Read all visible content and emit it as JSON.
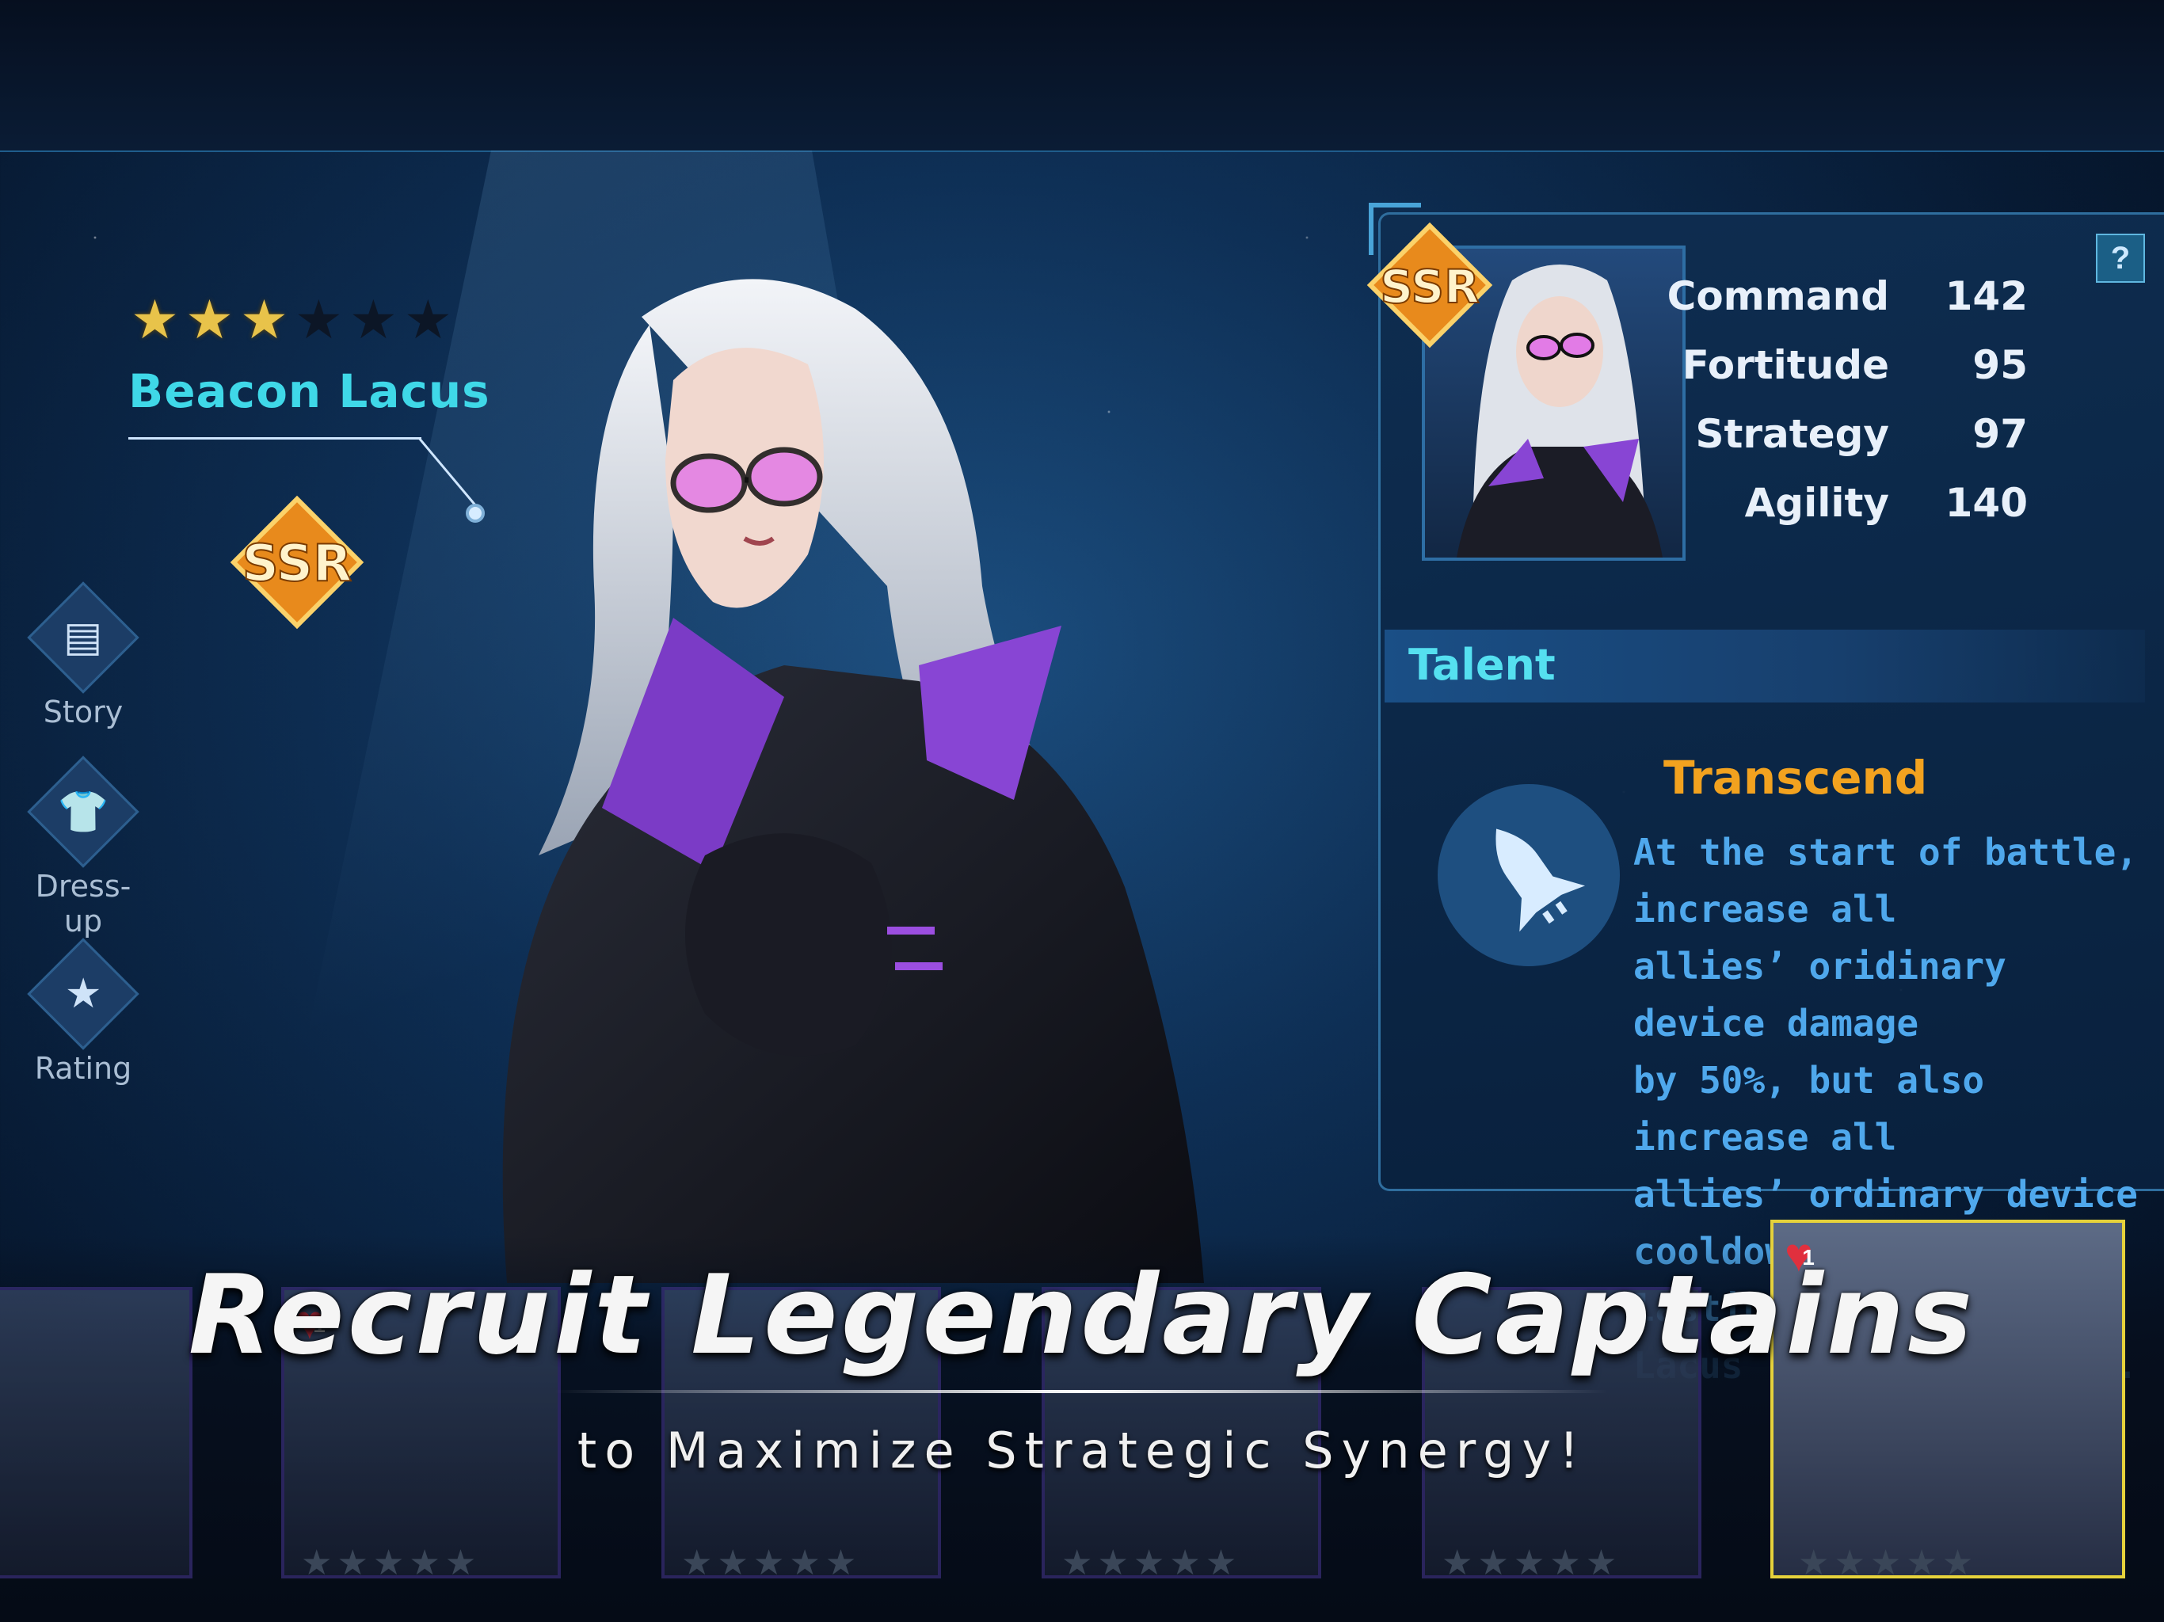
{
  "hero": {
    "stars_filled": 3,
    "stars_total": 6,
    "name": "Beacon Lacus",
    "rarity": "SSR"
  },
  "side_menu": [
    {
      "label": "Story",
      "icon": "book-icon"
    },
    {
      "label": "Dress-up",
      "icon": "shirt-icon"
    },
    {
      "label": "Rating",
      "icon": "rating-card-icon"
    }
  ],
  "stats_panel": {
    "help": "?",
    "stats": [
      {
        "label": "Command",
        "value": "142"
      },
      {
        "label": "Fortitude",
        "value": "95"
      },
      {
        "label": "Strategy",
        "value": "97"
      },
      {
        "label": "Agility",
        "value": "140"
      }
    ]
  },
  "talent": {
    "header": "Talent",
    "name": "Transcend",
    "icon": "missile-icon",
    "description": "At the start of battle, increase all\nallies’  oridinary device damage\nby 50%, but also increase all\nallies’  ordinary device\ncooldowns by 30%, lasting until\nLacus leaves the field."
  },
  "captain_cards": [
    {
      "name": "captain-1",
      "badge": ""
    },
    {
      "name": "captain-2",
      "badge": "1"
    },
    {
      "name": "captain-3",
      "badge": ""
    },
    {
      "name": "captain-4",
      "badge": ""
    },
    {
      "name": "captain-5",
      "badge": ""
    },
    {
      "name": "captain-lacus",
      "badge": "1",
      "selected": true
    }
  ],
  "promo": {
    "headline": "Recruit Legendary Captains",
    "subline": "to Maximize Strategic Synergy!"
  },
  "colors": {
    "accent_cyan": "#3fd8e8",
    "talent_orange": "#f2a21f",
    "desc_blue": "#4fa8ec",
    "star_gold": "#e8c34a",
    "ssr_orange": "#f2a21f"
  }
}
